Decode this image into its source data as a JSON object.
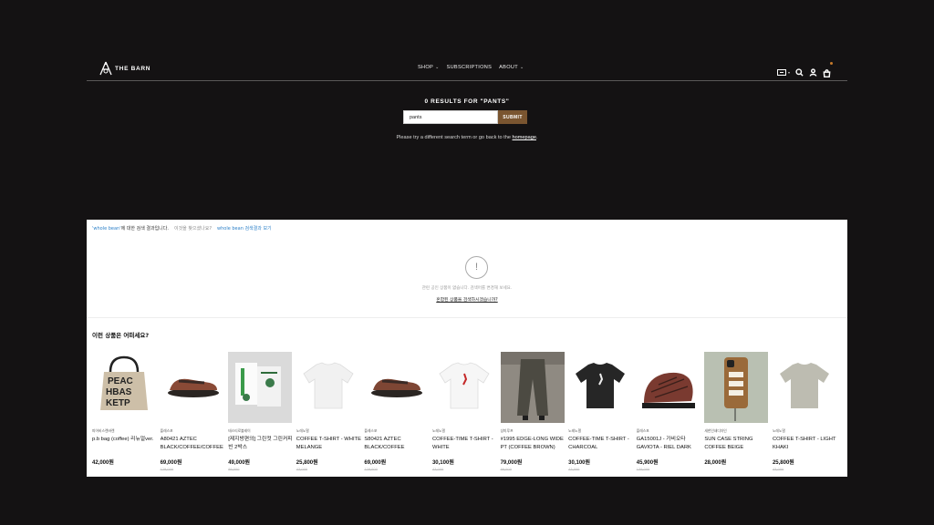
{
  "header": {
    "logo_text": "THE BARN",
    "nav": [
      {
        "label": "SHOP",
        "has_dropdown": true
      },
      {
        "label": "SUBSCRIPTIONS",
        "has_dropdown": false
      },
      {
        "label": "ABOUT",
        "has_dropdown": true
      }
    ],
    "icons": [
      "currency-flag-icon",
      "search-icon",
      "account-icon",
      "cart-icon"
    ]
  },
  "search": {
    "results_title": "0 RESULTS FOR \"PANTS\"",
    "input_value": "pants",
    "submit_label": "SUBMIT",
    "help_prefix": "Please try a different search term or go back to the ",
    "help_link": "homepage",
    "help_suffix": "."
  },
  "panel": {
    "query_keyword": "'whole bean'",
    "query_suffix": "에 대한 검색 결과입니다.",
    "alt_prompt": "이것을 찾으셨나요?",
    "alt_link": "whole bean 검색결과 보기",
    "empty_icon": "!",
    "empty_text": "관련 공인 상품이 없습니다. 검색어를 변경해 보세요.",
    "empty_link": "혼합된 상품을 검색하시겠습니까?",
    "rec_title": "이런 상품은 어떠세요?"
  },
  "products": [
    {
      "brand": "피어비스렌바렌",
      "name": "p.b bag (coffee) 리뉴얼ver.",
      "price": "42,000원",
      "orig": ""
    },
    {
      "brand": "플레스포",
      "name": "A80421 AZTEC BLACK/COFFEE/COFFEE",
      "price": "69,000원",
      "orig": "129,000"
    },
    {
      "brand": "테스티로볼레이",
      "name": "[제지방편의] 그린컷 그린커피빈 2박스",
      "price": "49,000원",
      "orig": "89,000"
    },
    {
      "brand": "노레노멀",
      "name": "COFFEE T-SHIRT - WHITE MELANGE",
      "price": "25,800원",
      "orig": "43,000"
    },
    {
      "brand": "플레스포",
      "name": "S80421 AZTEC BLACK/COFFEE",
      "price": "69,000원",
      "orig": "129,000"
    },
    {
      "brand": "노레노멀",
      "name": "COFFEE-TIME T-SHIRT - WHITE",
      "price": "30,100원",
      "orig": "43,000"
    },
    {
      "brand": "상미루프",
      "name": "#1995 EDGE-LONG WIDE PT (COFFEE BROWN)",
      "price": "79,000원",
      "orig": "99,000"
    },
    {
      "brand": "노레노멀",
      "name": "COFFEE-TIME T-SHIRT - CHARCOAL",
      "price": "30,100원",
      "orig": "43,000"
    },
    {
      "brand": "플레스포",
      "name": "GA15001J - 가비오타 GAVIOTA - RIEL DARK",
      "price": "45,900원",
      "orig": "139,000"
    },
    {
      "brand": "새한인쇄디자인",
      "name": "SUN CASE STRING COFFEE BEIGE",
      "price": "28,000원",
      "orig": ""
    },
    {
      "brand": "노레노멀",
      "name": "COFFEE T-SHIRT - LIGHT KHAKI",
      "price": "25,800원",
      "orig": "43,000"
    }
  ],
  "colors": {
    "page_bg": "#141213",
    "submit_bg": "#7a5530",
    "link_blue": "#2f82c9"
  }
}
